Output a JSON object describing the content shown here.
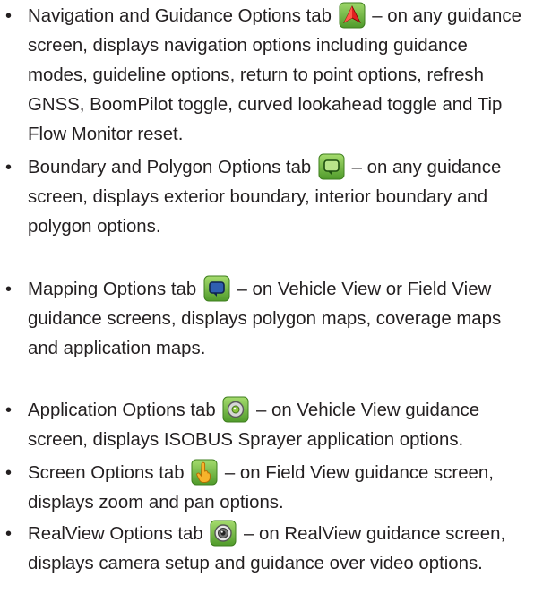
{
  "items": [
    {
      "tab_name": "Navigation and Guidance Options tab",
      "icon": "navigation-arrow-icon",
      "lines": [
        " – on any guidance",
        "screen, displays navigation options including guidance",
        "modes, guideline options, return to point options, refresh",
        "GNSS, BoomPilot toggle, curved lookahead toggle and Tip",
        "Flow Monitor reset."
      ]
    },
    {
      "tab_name": "Boundary and Polygon Options tab",
      "icon": "boundary-polygon-icon",
      "lines": [
        " – on any guidance",
        "screen, displays exterior boundary, interior boundary and",
        "polygon options."
      ]
    },
    {
      "tab_name": "Mapping Options tab",
      "icon": "mapping-icon",
      "lines": [
        " – on Vehicle View or Field View",
        "guidance screens, displays polygon maps, coverage maps",
        "and application maps."
      ]
    },
    {
      "tab_name": "Application Options tab",
      "icon": "application-nozzle-icon",
      "lines": [
        " – on Vehicle View guidance",
        "screen, displays ISOBUS Sprayer application options."
      ]
    },
    {
      "tab_name": "Screen Options tab",
      "icon": "hand-pointer-icon",
      "lines": [
        " – on Field View guidance screen,",
        "displays zoom and pan options."
      ]
    },
    {
      "tab_name": "RealView Options tab",
      "icon": "camera-lens-icon",
      "lines": [
        " – on RealView guidance screen,",
        "displays camera setup and guidance over video options."
      ]
    }
  ]
}
